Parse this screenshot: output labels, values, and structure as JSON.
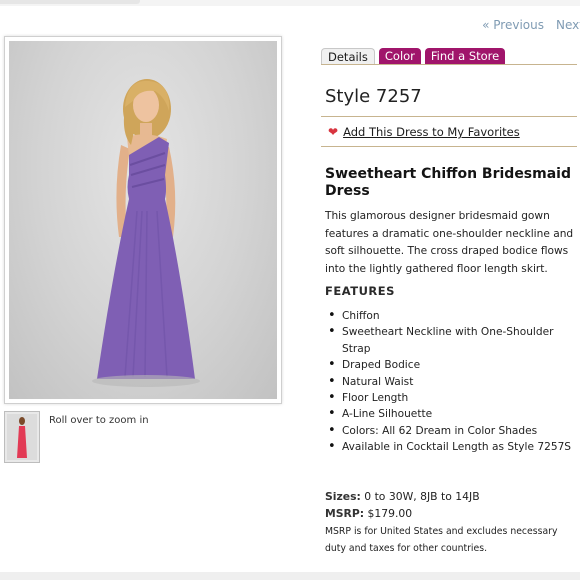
{
  "pager": {
    "previous": "« Previous",
    "next": "Next"
  },
  "photo": {
    "alt": "Model wearing purple one-shoulder chiffon gown",
    "dress_color": "#7f5fb4"
  },
  "thumbnail": {
    "dress_color": "#e23a55"
  },
  "zoom_hint": "Roll over to zoom in",
  "tabs": [
    {
      "label": "Details",
      "active": true
    },
    {
      "label": "Color",
      "active": false
    },
    {
      "label": "Find a Store",
      "active": false
    }
  ],
  "style_number": "Style 7257",
  "favorites": {
    "label": "Add This Dress to My Favorites",
    "icon": "heart-icon"
  },
  "product": {
    "title": "Sweetheart Chiffon Bridesmaid Dress",
    "description": "This glamorous designer bridesmaid gown features a dramatic one-shoulder neckline and soft silhouette. The cross draped bodice flows into the lightly gathered floor length skirt."
  },
  "features": {
    "heading": "FEATURES",
    "items": [
      "Chiffon",
      "Sweetheart Neckline with One-Shoulder Strap",
      "Draped Bodice",
      "Natural Waist",
      "Floor Length",
      "A-Line Silhouette",
      "Colors: All 62 Dream in Color Shades",
      "Available in Cocktail Length as Style 7257S"
    ]
  },
  "sizes": {
    "label": "Sizes:",
    "value": "0 to 30W, 8JB to 14JB"
  },
  "msrp": {
    "label": "MSRP:",
    "value": "$179.00"
  },
  "note": "MSRP is for United States and excludes necessary duty and taxes for other countries.",
  "colors": {
    "accent_tab": "#a0156b",
    "rule": "#c7b48f",
    "pager_link": "#7f9bb3"
  }
}
